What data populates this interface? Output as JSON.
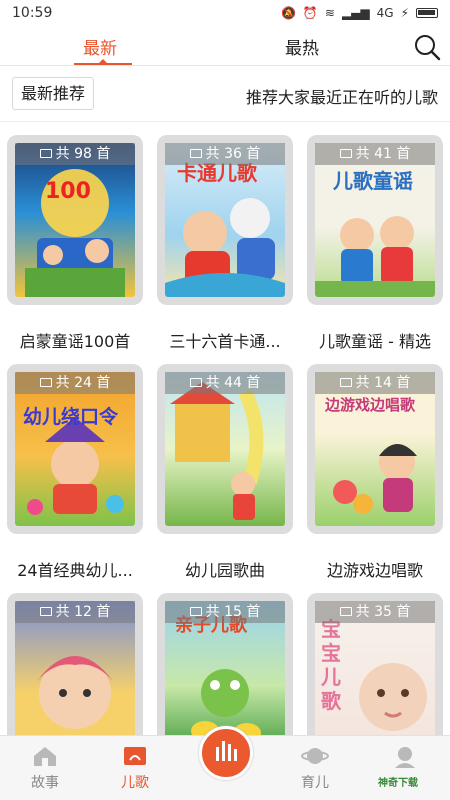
{
  "status": {
    "time": "10:59",
    "network": "4G"
  },
  "topnav": {
    "tab_new": "最新",
    "tab_hot": "最热"
  },
  "recommend": {
    "tag": "最新推荐",
    "description": "推荐大家最近正在听的儿歌"
  },
  "albums": [
    {
      "count": "共 98 首",
      "title": "启蒙童谣100首",
      "cover_text": "100",
      "cover_colors": [
        "#2a8fd6",
        "#f2c43a"
      ]
    },
    {
      "count": "共 36 首",
      "title": "三十六首卡通...",
      "cover_text": "卡通儿歌",
      "cover_colors": [
        "#d8edf7",
        "#e63a2e"
      ]
    },
    {
      "count": "共 41 首",
      "title": "儿歌童谣 - 精选",
      "cover_text": "儿歌童谣",
      "cover_colors": [
        "#f4f1e6",
        "#74b64c"
      ]
    },
    {
      "count": "共 24 首",
      "title": "24首经典幼儿...",
      "cover_text": "幼儿绕口令",
      "cover_colors": [
        "#f3a22c",
        "#7fc24a"
      ]
    },
    {
      "count": "共 44 首",
      "title": "幼儿园歌曲",
      "cover_text": "",
      "cover_colors": [
        "#bfe4f2",
        "#76b64a"
      ]
    },
    {
      "count": "共 14 首",
      "title": "边游戏边唱歌",
      "cover_text": "边游戏边唱歌",
      "cover_colors": [
        "#fbf3d9",
        "#c53a7a"
      ]
    },
    {
      "count": "共 12 首",
      "title": "",
      "cover_text": "",
      "cover_colors": [
        "#f6d16a",
        "#e25a77"
      ]
    },
    {
      "count": "共 15 首",
      "title": "",
      "cover_text": "亲子儿歌",
      "cover_colors": [
        "#9ad3ef",
        "#3c9a3a"
      ]
    },
    {
      "count": "共 35 首",
      "title": "",
      "cover_text": "宝宝儿歌",
      "cover_colors": [
        "#f7f1ec",
        "#e6739a"
      ]
    }
  ],
  "bottom_nav": {
    "story": "故事",
    "song": "儿歌",
    "parenting": "育儿"
  },
  "watermark": "神奇下载",
  "colors": {
    "accent": "#e9552e"
  }
}
